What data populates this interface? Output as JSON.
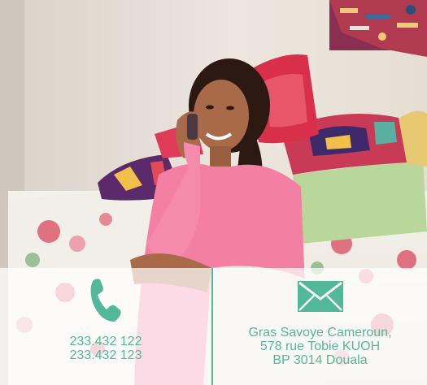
{
  "colors": {
    "accent": "#53b79a",
    "wall": "#e8e1d8",
    "shirt": "#f47fa4"
  },
  "photo": {
    "description_icon": "woman-on-phone-photo"
  },
  "contact": {
    "phone": {
      "icon": "phone-icon",
      "numbers": [
        "233.432 122",
        "233.432 123"
      ]
    },
    "address": {
      "icon": "envelope-icon",
      "lines": [
        "Gras Savoye Cameroun,",
        "578 rue Tobie KUOH",
        "BP 3014 Douala"
      ]
    }
  }
}
